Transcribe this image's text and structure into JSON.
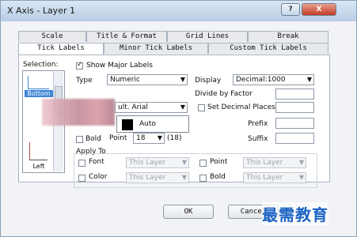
{
  "window": {
    "title": "X Axis - Layer 1",
    "help": "?",
    "close": "X"
  },
  "tabs_row1": [
    "Scale",
    "Title & Format",
    "Grid Lines",
    "Break"
  ],
  "tabs_row2": [
    "Tick Labels",
    "Minor Tick Labels",
    "Custom Tick Labels"
  ],
  "selection": {
    "label": "Selection:",
    "items": [
      "Bottom",
      "Left"
    ]
  },
  "show_major": {
    "label": "Show Major Labels",
    "checked": true
  },
  "type": {
    "label": "Type",
    "value": "Numeric"
  },
  "display": {
    "label": "Display",
    "value": "Decimal:1000"
  },
  "divide": {
    "label": "Divide by Factor"
  },
  "decimal": {
    "label": "Set Decimal Places"
  },
  "prefix": {
    "label": "Prefix"
  },
  "suffix": {
    "label": "Suffix"
  },
  "font": {
    "value": "ult. Arial"
  },
  "color_dropdown": {
    "value": "Auto"
  },
  "bold_point": {
    "bold_label": "Bold",
    "point_label": "Point",
    "point_value": "18",
    "point_hint": "(18)"
  },
  "apply_to": {
    "label": "Apply To",
    "rows": [
      {
        "left_label": "Font",
        "left_value": "This Layer",
        "right_label": "Point",
        "right_value": "This Layer"
      },
      {
        "left_label": "Color",
        "left_value": "This Layer",
        "right_label": "Bold",
        "right_value": "This Layer"
      }
    ]
  },
  "buttons": {
    "ok": "OK",
    "cancel": "Cancel"
  },
  "watermark": "最需教育"
}
